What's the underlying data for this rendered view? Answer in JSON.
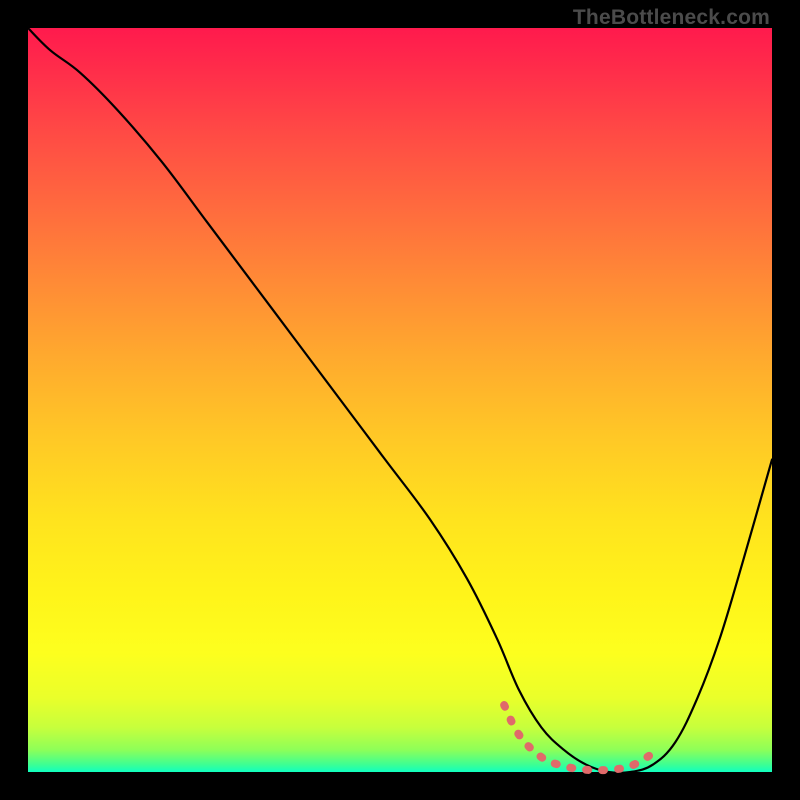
{
  "attribution": "TheBottleneck.com",
  "chart_data": {
    "type": "line",
    "title": "",
    "xlabel": "",
    "ylabel": "",
    "xlim": [
      0,
      100
    ],
    "ylim": [
      0,
      100
    ],
    "grid": false,
    "legend": false,
    "annotations": [],
    "note": "x-axis and y-axis are normalized 0-100 units; y=100 is the top, y=0 the bottom green edge; values were read from curve position relative to the gradient box.",
    "series": [
      {
        "name": "curve",
        "color": "#000000",
        "x": [
          0,
          3,
          7,
          12,
          18,
          24,
          30,
          36,
          42,
          48,
          54,
          59,
          63,
          66,
          69,
          72,
          75,
          78,
          81,
          84,
          87,
          90,
          93,
          96,
          100
        ],
        "y": [
          100,
          97,
          94,
          89,
          82,
          74,
          66,
          58,
          50,
          42,
          34,
          26,
          18,
          11,
          6,
          3,
          1,
          0,
          0,
          1,
          4,
          10,
          18,
          28,
          42
        ]
      },
      {
        "name": "highlight-segment",
        "color": "#e06a6a",
        "style": "dashed-thick",
        "x": [
          64,
          66,
          69,
          72,
          75,
          78,
          81,
          84
        ],
        "y": [
          9,
          5,
          2,
          0.8,
          0.3,
          0.3,
          0.8,
          2.5
        ]
      }
    ],
    "background_gradient_stops": [
      {
        "pos": 0,
        "color": "#ff1a4d"
      },
      {
        "pos": 34,
        "color": "#ff8a36"
      },
      {
        "pos": 66,
        "color": "#ffe31e"
      },
      {
        "pos": 90,
        "color": "#eaff2a"
      },
      {
        "pos": 100,
        "color": "#10ffc0"
      }
    ]
  }
}
